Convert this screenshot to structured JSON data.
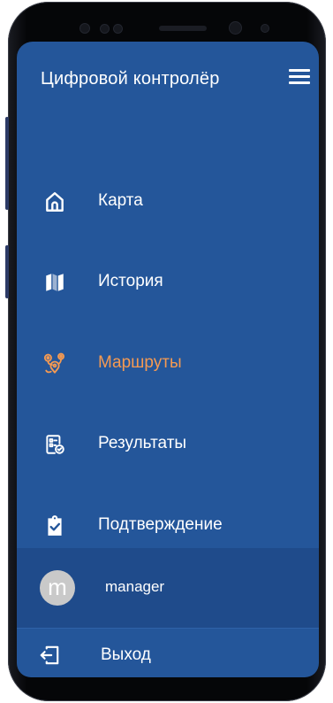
{
  "app": {
    "title": "Цифровой контролёр"
  },
  "header": {
    "menu_icon": "hamburger-menu-icon"
  },
  "menu": {
    "items": [
      {
        "id": "map",
        "label": "Карта",
        "icon": "home-icon",
        "active": false
      },
      {
        "id": "history",
        "label": "История",
        "icon": "map-icon",
        "active": false
      },
      {
        "id": "routes",
        "label": "Маршруты",
        "icon": "route-pins-icon",
        "active": true
      },
      {
        "id": "results",
        "label": "Результаты",
        "icon": "checklist-icon",
        "active": false
      },
      {
        "id": "confirm",
        "label": "Подтверждение",
        "icon": "clipboard-check-icon",
        "active": false
      }
    ]
  },
  "user": {
    "avatar_letter": "m",
    "name": "manager"
  },
  "logout": {
    "label": "Выход",
    "icon": "logout-icon"
  },
  "colors": {
    "background": "#24569a",
    "user_row": "#1f4b8b",
    "active": "#f59a52",
    "text": "#ffffff"
  }
}
